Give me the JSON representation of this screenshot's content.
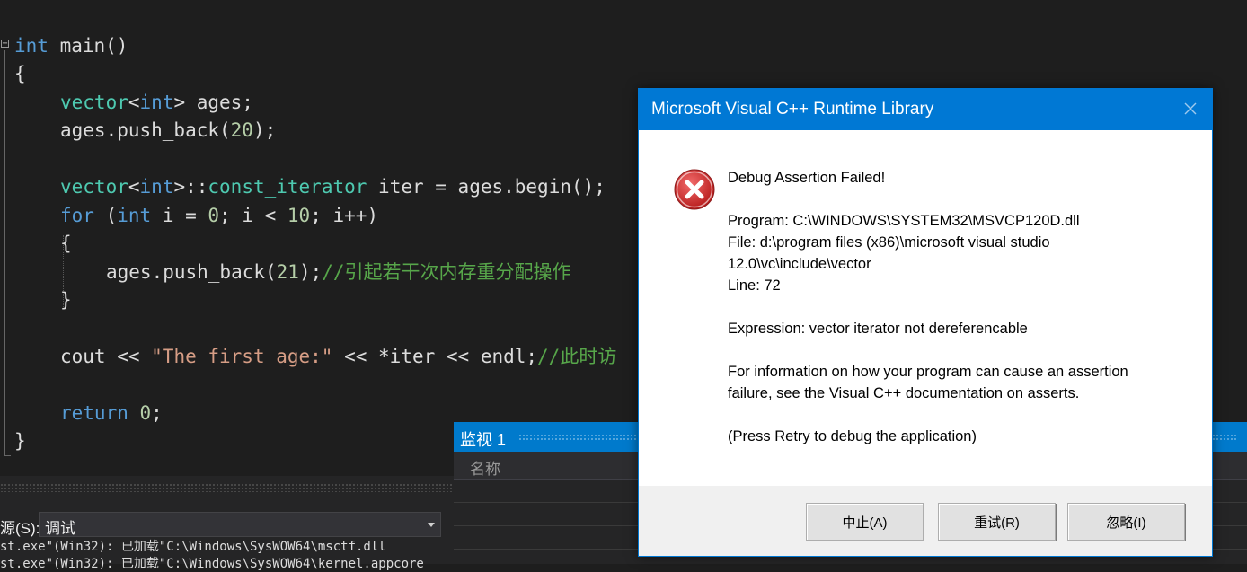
{
  "editor": {
    "lines": {
      "l1": {
        "kw": "int",
        "rest": " main()"
      },
      "l2": "{",
      "l3": {
        "ty": "vector",
        "p1": "<",
        "kw": "int",
        "p2": "> ages;"
      },
      "l4": {
        "a": "ages.push_back(",
        "num": "20",
        "b": ");"
      },
      "l5": {
        "ty": "vector",
        "p1": "<",
        "kw": "int",
        "p2": ">::",
        "ty2": "const_iterator",
        "rest": " iter = ages.begin();"
      },
      "l6": {
        "kw": "for",
        "a": " (",
        "kw2": "int",
        "b": " i = ",
        "n1": "0",
        "c": "; i < ",
        "n2": "10",
        "d": "; i++)"
      },
      "l7": "{",
      "l8": {
        "a": "ages.push_back(",
        "num": "21",
        "b": ");",
        "cm": "//引起若干次内存重分配操作"
      },
      "l9": "}",
      "l10": {
        "a": "cout << ",
        "str": "\"The first age:\"",
        "b": " << *iter << endl;",
        "cm": "//此时访"
      },
      "l11": {
        "kw": "return",
        "a": " ",
        "num": "0",
        "b": ";"
      },
      "l12": "}"
    },
    "fold_symbol": "−"
  },
  "output": {
    "source_label": "源(S):",
    "source_value": "调试",
    "lines": [
      "st.exe\"(Win32): 已加载\"C:\\Windows\\SysWOW64\\msctf.dll",
      "st.exe\"(Win32): 已加载\"C:\\Windows\\SysWOW64\\kernel.appcore"
    ]
  },
  "watch": {
    "title": "监视 1",
    "name_column": "名称"
  },
  "dialog": {
    "title": "Microsoft Visual C++ Runtime Library",
    "heading": "Debug Assertion Failed!",
    "program": "Program: C:\\WINDOWS\\SYSTEM32\\MSVCP120D.dll",
    "file1": "File: d:\\program files (x86)\\microsoft visual studio",
    "file2": "12.0\\vc\\include\\vector",
    "line": "Line: 72",
    "expression": "Expression: vector iterator not dereferencable",
    "info1": "For information on how your program can cause an assertion",
    "info2": "failure, see the Visual C++ documentation on asserts.",
    "retry_hint": "(Press Retry to debug the application)",
    "buttons": {
      "abort": "中止(A)",
      "retry": "重试(R)",
      "ignore": "忽略(I)"
    }
  },
  "colors": {
    "accent": "#0078d4",
    "ide_accent": "#007acc",
    "error_red": "#d32f2f"
  }
}
